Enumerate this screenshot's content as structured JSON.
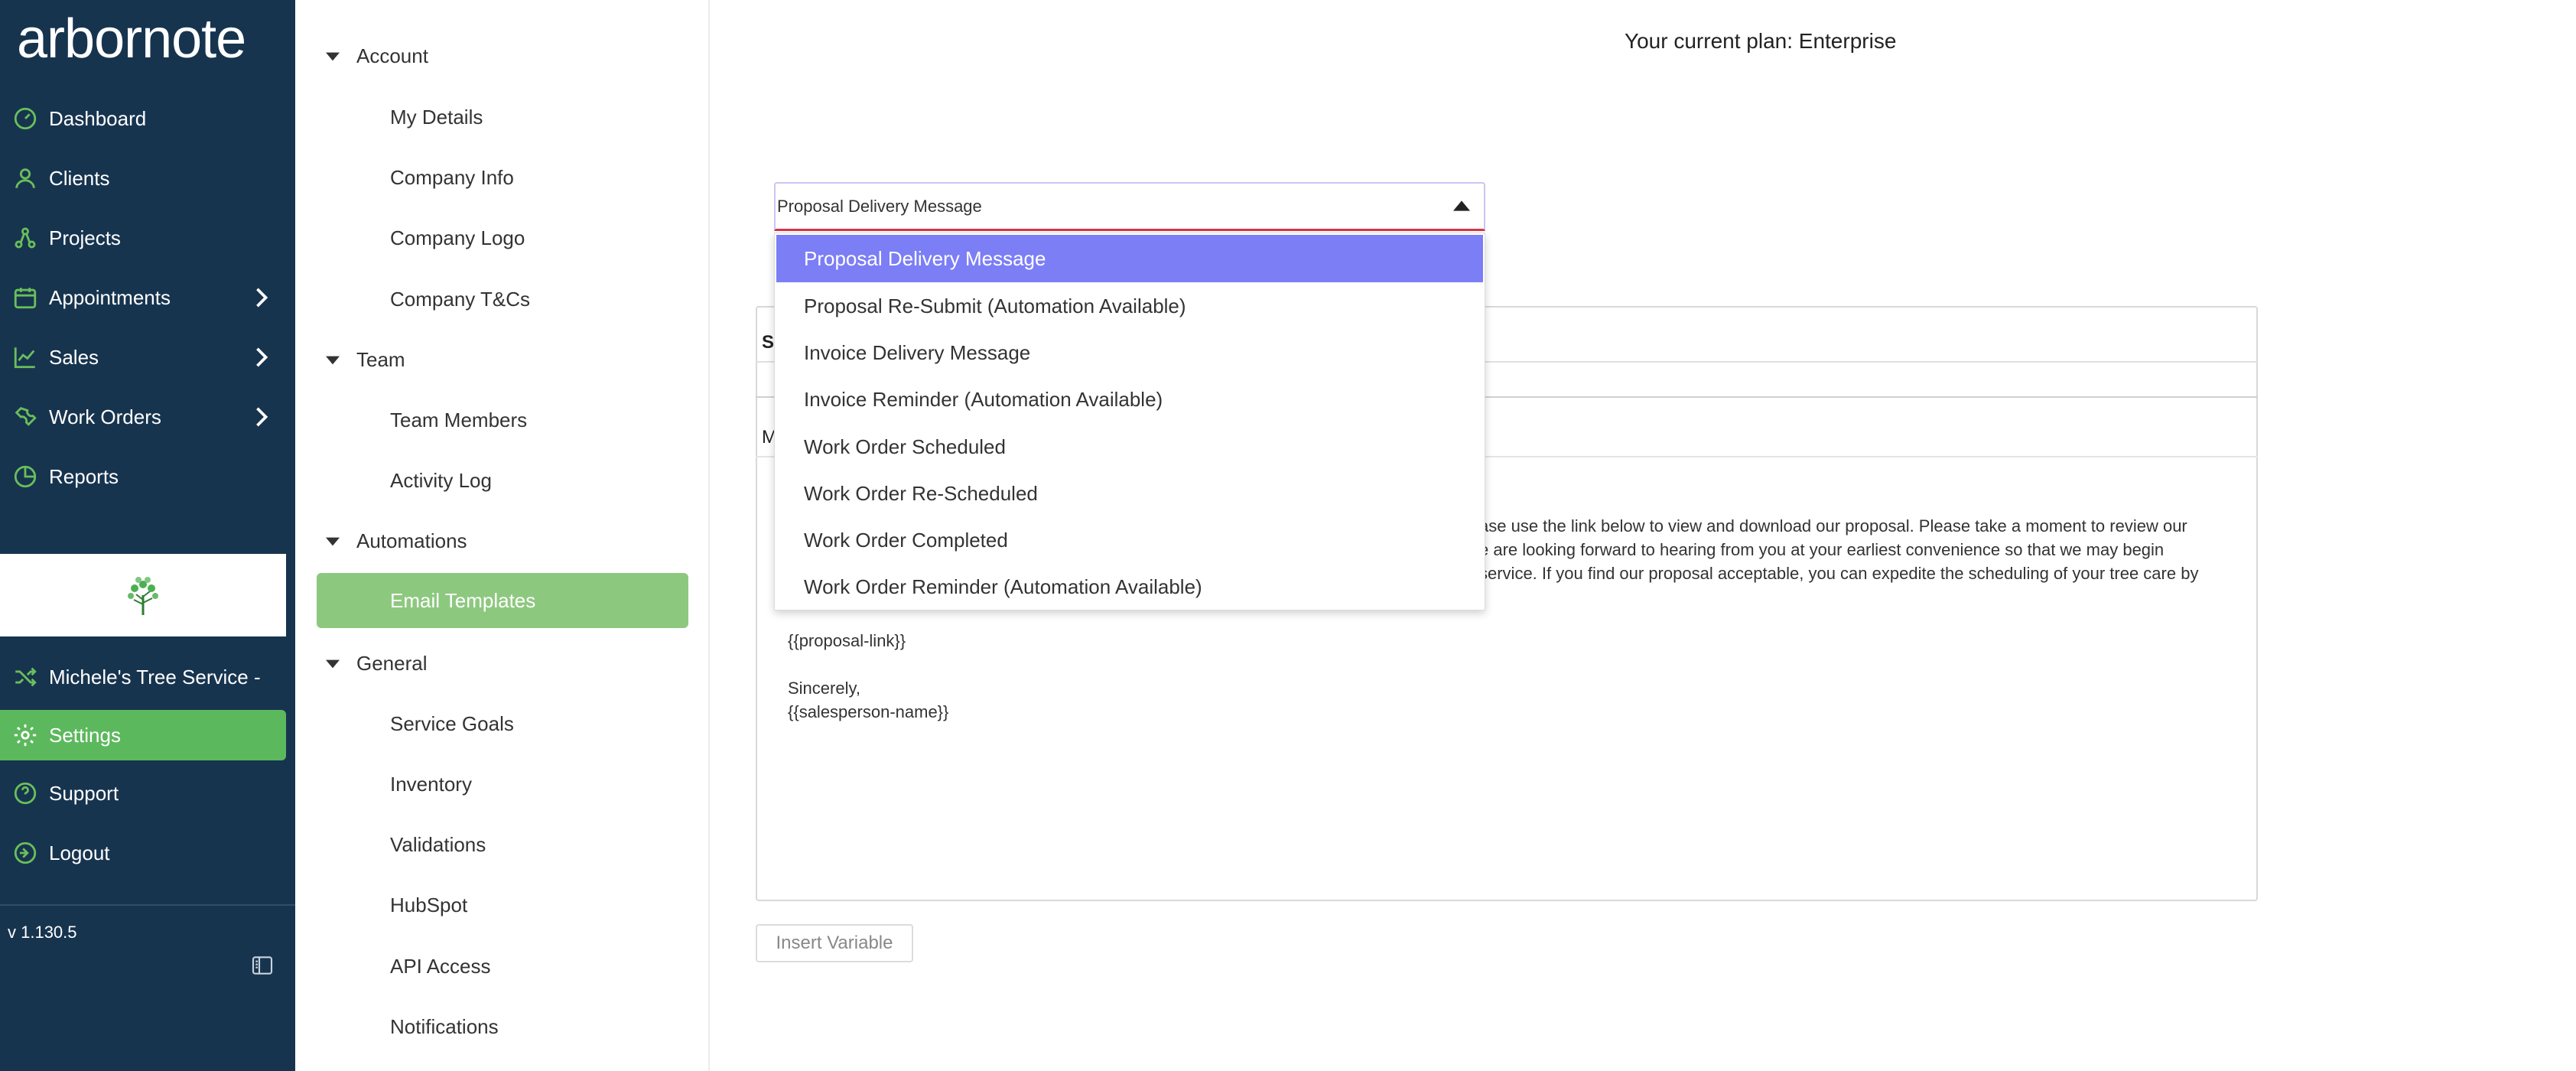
{
  "brand": {
    "logo_text": "arbornote",
    "accent": "#5cb85c",
    "sidebar_bg": "#17344f"
  },
  "sidebar": {
    "items": [
      {
        "label": "Dashboard",
        "icon": "dashboard-icon",
        "chevron": false
      },
      {
        "label": "Clients",
        "icon": "user-icon",
        "chevron": false
      },
      {
        "label": "Projects",
        "icon": "projects-icon",
        "chevron": false
      },
      {
        "label": "Appointments",
        "icon": "calendar-icon",
        "chevron": true
      },
      {
        "label": "Sales",
        "icon": "chart-line-icon",
        "chevron": true
      },
      {
        "label": "Work Orders",
        "icon": "wrench-icon",
        "chevron": true
      },
      {
        "label": "Reports",
        "icon": "pie-chart-icon",
        "chevron": false
      }
    ],
    "company_name": "Michele's Tree Service -",
    "bottom_items": [
      {
        "label": "Settings",
        "icon": "gear-icon",
        "active": true
      },
      {
        "label": "Support",
        "icon": "help-icon",
        "active": false
      },
      {
        "label": "Logout",
        "icon": "logout-icon",
        "active": false
      }
    ],
    "version": "v 1.130.5"
  },
  "settings_nav": {
    "sections": [
      {
        "label": "Account",
        "items": [
          "My Details",
          "Company Info",
          "Company Logo",
          "Company T&Cs"
        ]
      },
      {
        "label": "Team",
        "items": [
          "Team Members",
          "Activity Log"
        ]
      },
      {
        "label": "Automations",
        "items": [
          "Email Templates"
        ]
      },
      {
        "label": "General",
        "items": [
          "Service Goals",
          "Inventory",
          "Validations",
          "HubSpot",
          "API Access",
          "Notifications"
        ]
      }
    ],
    "active_item": "Email Templates"
  },
  "main": {
    "plan_text": "Your current plan: Enterprise",
    "template_select": {
      "value": "Proposal Delivery Message",
      "options": [
        "Proposal Delivery Message",
        "Proposal Re-Submit (Automation Available)",
        "Invoice Delivery Message",
        "Invoice Reminder (Automation Available)",
        "Work Order Scheduled",
        "Work Order Re-Scheduled",
        "Work Order Completed",
        "Work Order Reminder (Automation Available)"
      ],
      "selected_index": 0
    },
    "subject_label_fragment": "S",
    "message_label_fragment": "M",
    "message_lines_partial": [
      "ase use the link below to view and download our proposal. Please take a moment to review our",
      "e are looking forward to hearing from you at your earliest convenience so that we may begin",
      "service. If you find our proposal acceptable, you can expedite the scheduling of your tree care by"
    ],
    "message_lines": [
      "{{proposal-link}}",
      "",
      "Sincerely,",
      "{{salesperson-name}}"
    ],
    "insert_variable_label": "Insert Variable"
  }
}
